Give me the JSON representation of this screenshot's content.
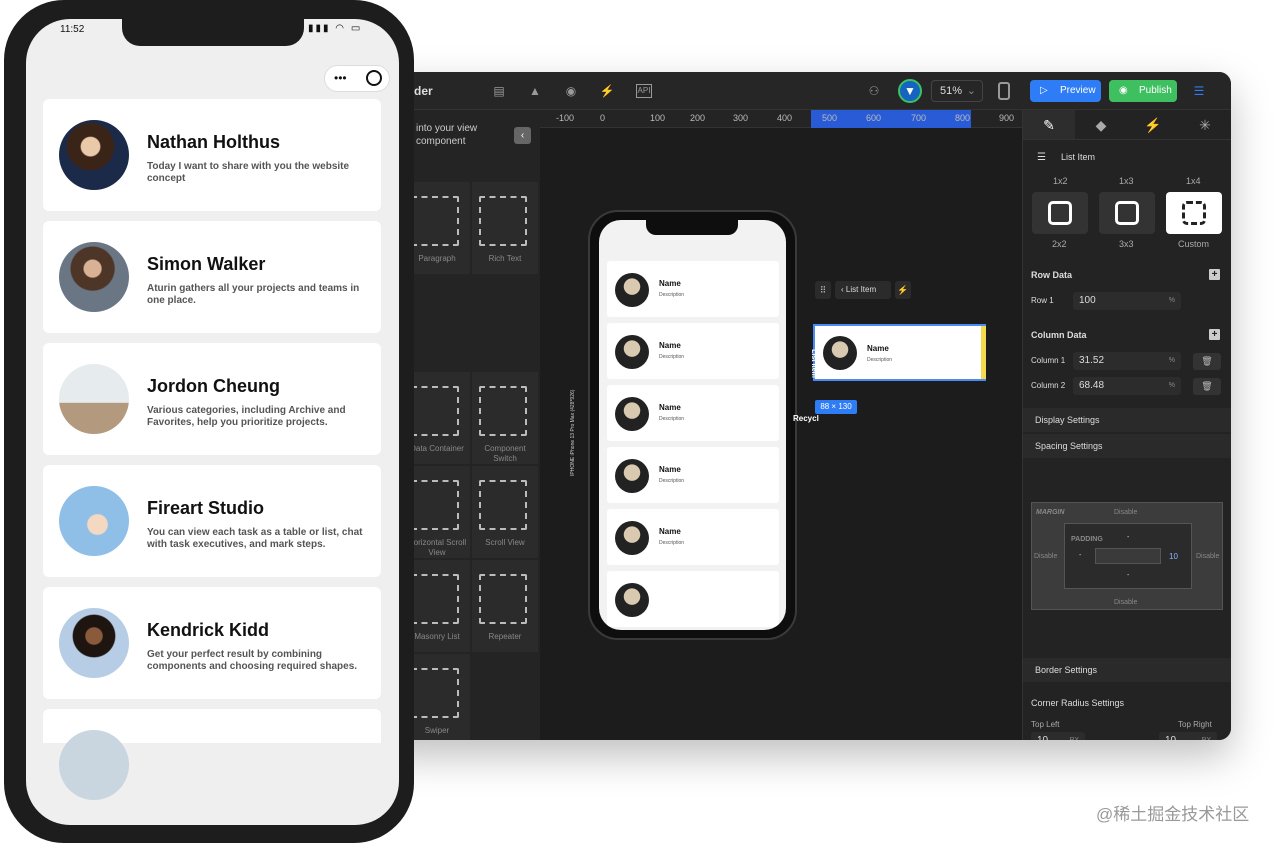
{
  "mobile": {
    "status_time": "11:52",
    "profiles": [
      {
        "name": "Nathan Holthus",
        "desc": "Today I want to share with you the website concept"
      },
      {
        "name": "Simon Walker",
        "desc": "Aturin gathers all your projects and teams in one place."
      },
      {
        "name": "Jordon Cheung",
        "desc": "Various categories, including Archive and Favorites, help you prioritize projects."
      },
      {
        "name": "Fireart Studio",
        "desc": "You can view each task as a table or list, chat with task executives, and mark steps."
      },
      {
        "name": "Kendrick Kidd",
        "desc": "Get your perfect result by combining components and choosing required shapes."
      }
    ]
  },
  "editor": {
    "title": "der",
    "zoom": "51%",
    "preview_label": "Preview",
    "publish_label": "Publish",
    "api_label": "API",
    "ruler_ticks": [
      "-100",
      "0",
      "100",
      "200",
      "300",
      "400",
      "500",
      "600",
      "700",
      "800",
      "900"
    ],
    "left_panel": {
      "header": "into your view component",
      "components": [
        "Paragraph",
        "Rich Text",
        "Data Container",
        "Component Switch",
        "Horizontal Scroll View",
        "Scroll View",
        "Masonry List",
        "Repeater",
        "Swiper"
      ]
    },
    "canvas": {
      "device_label": "IPHONE   iPhone 13 Pro Max (428*926)",
      "card_name": "Name",
      "card_desc": "Description",
      "toolbar_label": "List Item",
      "selected_size": "88 × 130",
      "side_tag": "List Item",
      "recycle_label": "Recycl"
    },
    "right_panel": {
      "component_name": "List Item",
      "grid_top_labels": [
        "1x2",
        "1x3",
        "1x4"
      ],
      "grid_bottom_labels": [
        "2x2",
        "3x3",
        "Custom"
      ],
      "row_data_title": "Row Data",
      "row1_label": "Row 1",
      "row1_value": "100",
      "column_data_title": "Column Data",
      "col1_label": "Column 1",
      "col1_value": "31.52",
      "col2_label": "Column 2",
      "col2_value": "68.48",
      "percent": "%",
      "display_settings": "Display Settings",
      "spacing_settings": "Spacing Settings",
      "margin_label": "MARGIN",
      "padding_label": "PADDING",
      "disable": "Disable",
      "dash": "-",
      "padding_right": "10",
      "border_settings": "Border Settings",
      "corner_radius": "Corner Radius Settings",
      "top_left_label": "Top Left",
      "top_left_value": "10",
      "top_right_label": "Top Right",
      "top_right_value": "10",
      "px": "PX"
    }
  },
  "watermark": "@稀土掘金技术社区"
}
